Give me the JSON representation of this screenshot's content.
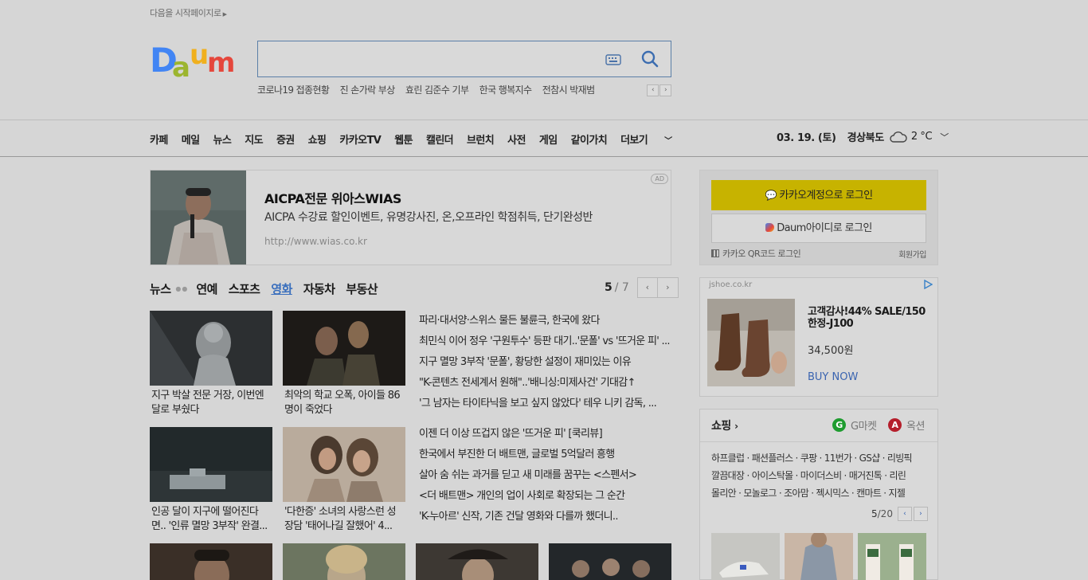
{
  "header": {
    "start_page_text": "다음을 시작페이지로",
    "logo_text": "Daum"
  },
  "search": {
    "placeholder": "",
    "trends": [
      "코로나19 접종현황",
      "진 손가락 부상",
      "효린 김준수 기부",
      "한국 행복지수",
      "전참시 박재범"
    ]
  },
  "nav": {
    "items": [
      "카페",
      "메일",
      "뉴스",
      "지도",
      "증권",
      "쇼핑",
      "카카오TV",
      "웹툰",
      "캘린더",
      "브런치",
      "사전",
      "게임",
      "같이가치",
      "더보기"
    ],
    "date": "03. 19. (토)",
    "region": "경상북도",
    "temperature": "2 °C"
  },
  "ad": {
    "title": "AICPA전문 위아스WIAS",
    "description": "AICPA 수강료 할인이벤트, 유명강사진, 온,오프라인 학점취득, 단기완성반",
    "url": "http://www.wias.co.kr",
    "badge": "AD"
  },
  "news": {
    "tabs": [
      "뉴스",
      "연예",
      "스포츠",
      "영화",
      "자동차",
      "부동산"
    ],
    "active_tab": "영화",
    "page_current": "5",
    "page_total": "/ 7",
    "thumbs": [
      {
        "caption": "지구 박살 전문 거장, 이번엔 달로 부쉈다"
      },
      {
        "caption": "최악의 학교 오폭, 아이들 86명이 죽었다"
      },
      {
        "caption": "인공 달이 지구에 떨어진다면.. '인류 멸망 3부작' 완결..."
      },
      {
        "caption": "'다한증' 소녀의 사랑스런 성장담 '태어나길 잘했어' 4..."
      }
    ],
    "list_top": [
      "파리·대서양·스위스 물든 불륜극, 한국에 왔다",
      "최민식 이어 정우 '구원투수' 등판 대기..'문폴' vs '뜨거운 피' ...",
      "지구 멸망 3부작 '문폴', 황당한 설정이 재미있는 이유",
      "\"K-콘텐츠 전세계서 원해\"..'배니싱:미제사건' 기대감↑",
      "'그 남자는 타이타닉을 보고 싶지 않았다' 테우 니키 감독, ..."
    ],
    "list_bottom": [
      "이젠 더 이상 뜨겁지 않은 '뜨거운 피' [쿡리뷰]",
      "한국에서 부진한 더 배트맨, 글로벌 5억달러 흥행",
      "살아 숨 쉬는 과거를 딛고 새 미래를 꿈꾸는 <스펜서>",
      "<더 배트맨> 개인의 업이 사회로 확장되는 그 순간",
      "'K-누아르' 신작, 기존 건달 영화와 다를까 했더니.."
    ]
  },
  "login": {
    "kakao_label": "카카오계정으로 로그인",
    "daum_label": "Daum아이디로 로그인",
    "qr_label": "카카오 QR코드 로그인",
    "signup_label": "회원가입"
  },
  "shoe_ad": {
    "domain": "jshoe.co.kr",
    "title": "고객감사!44% SALE/150한정-J100",
    "price": "34,500원",
    "cta": "BUY NOW"
  },
  "shopping": {
    "title": "쇼핑",
    "gmarket": "G마켓",
    "auction": "옥션",
    "links": [
      "하프클럽 · 패션플러스 · 쿠팡 · 11번가 · GS샵 · 리빙픽",
      "깔끔대장 · 아이스탁몰 · 마이더스비 · 매거진톡 · 리린",
      "몰리안 · 모놀로그 · 조아맘 · 젝시믹스 · 캔마트 · 지젤"
    ],
    "page_current": "5",
    "page_total": "/20"
  },
  "colors": {
    "background": "#d6d6d6",
    "kakao_yellow": "#c7b300",
    "link_blue": "#3a64b0",
    "active_tab_blue": "#3a6fbd"
  }
}
